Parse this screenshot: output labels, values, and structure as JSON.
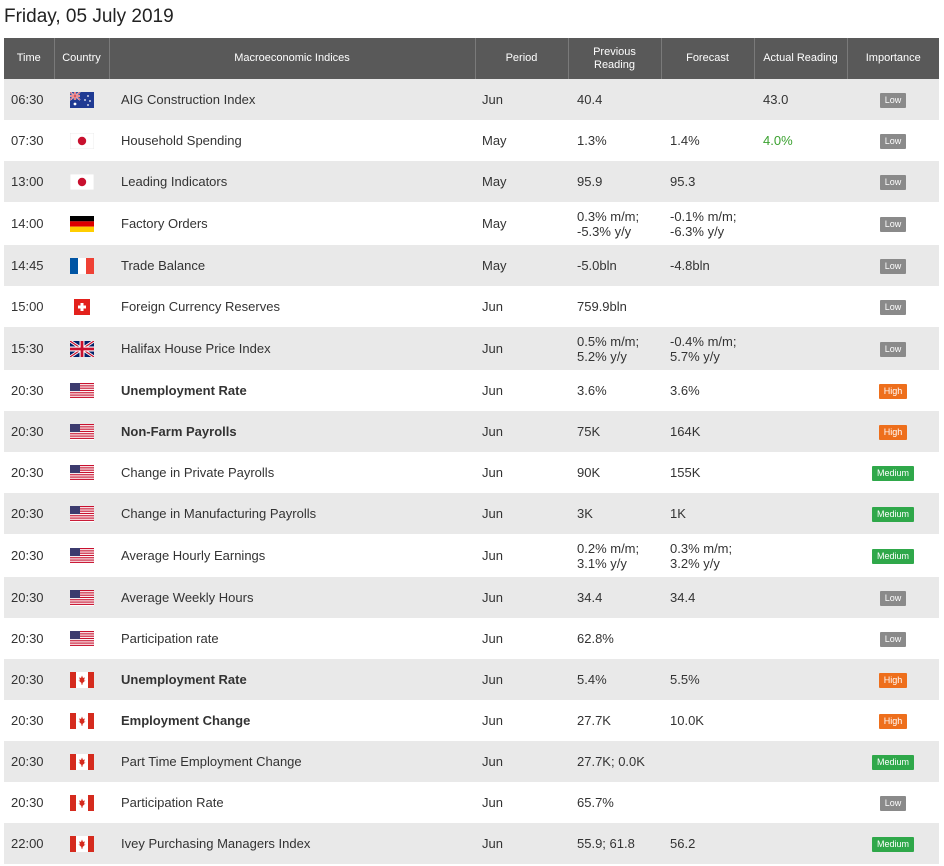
{
  "page": {
    "title": "Friday, 05 July 2019"
  },
  "table": {
    "headers": {
      "time": "Time",
      "country": "Country",
      "indices": "Macroeconomic Indices",
      "period": "Period",
      "previous": "Previous Reading",
      "forecast": "Forecast",
      "actual": "Actual Reading",
      "importance": "Importance"
    },
    "rows": [
      {
        "time": "06:30",
        "country": "au",
        "name": "AIG Construction Index",
        "bold": false,
        "period": "Jun",
        "prev": "40.4",
        "forecast": "",
        "actual": "43.0",
        "actual_green": false,
        "importance": "Low",
        "imp_level": "low"
      },
      {
        "time": "07:30",
        "country": "jp",
        "name": "Household Spending",
        "bold": false,
        "period": "May",
        "prev": "1.3%",
        "forecast": "1.4%",
        "actual": "4.0%",
        "actual_green": true,
        "importance": "Low",
        "imp_level": "low"
      },
      {
        "time": "13:00",
        "country": "jp",
        "name": "Leading Indicators",
        "bold": false,
        "period": "May",
        "prev": "95.9",
        "forecast": "95.3",
        "actual": "",
        "actual_green": false,
        "importance": "Low",
        "imp_level": "low"
      },
      {
        "time": "14:00",
        "country": "de",
        "name": "Factory Orders",
        "bold": false,
        "period": "May",
        "prev": "0.3% m/m;\n-5.3% y/y",
        "forecast": "-0.1% m/m;\n-6.3% y/y",
        "actual": "",
        "actual_green": false,
        "importance": "Low",
        "imp_level": "low"
      },
      {
        "time": "14:45",
        "country": "fr",
        "name": "Trade Balance",
        "bold": false,
        "period": "May",
        "prev": "-5.0bln",
        "forecast": "-4.8bln",
        "actual": "",
        "actual_green": false,
        "importance": "Low",
        "imp_level": "low"
      },
      {
        "time": "15:00",
        "country": "ch",
        "name": "Foreign Currency Reserves",
        "bold": false,
        "period": "Jun",
        "prev": "759.9bln",
        "forecast": "",
        "actual": "",
        "actual_green": false,
        "importance": "Low",
        "imp_level": "low"
      },
      {
        "time": "15:30",
        "country": "gb",
        "name": "Halifax House Price Index",
        "bold": false,
        "period": "Jun",
        "prev": "0.5% m/m;\n5.2% y/y",
        "forecast": "-0.4% m/m;\n5.7% y/y",
        "actual": "",
        "actual_green": false,
        "importance": "Low",
        "imp_level": "low"
      },
      {
        "time": "20:30",
        "country": "us",
        "name": "Unemployment Rate",
        "bold": true,
        "period": "Jun",
        "prev": "3.6%",
        "forecast": "3.6%",
        "actual": "",
        "actual_green": false,
        "importance": "High",
        "imp_level": "high"
      },
      {
        "time": "20:30",
        "country": "us",
        "name": "Non-Farm Payrolls",
        "bold": true,
        "period": "Jun",
        "prev": "75K",
        "forecast": "164K",
        "actual": "",
        "actual_green": false,
        "importance": "High",
        "imp_level": "high"
      },
      {
        "time": "20:30",
        "country": "us",
        "name": "Change in Private Payrolls",
        "bold": false,
        "period": "Jun",
        "prev": "90K",
        "forecast": "155K",
        "actual": "",
        "actual_green": false,
        "importance": "Medium",
        "imp_level": "medium"
      },
      {
        "time": "20:30",
        "country": "us",
        "name": "Change in Manufacturing Payrolls",
        "bold": false,
        "period": "Jun",
        "prev": "3K",
        "forecast": "1K",
        "actual": "",
        "actual_green": false,
        "importance": "Medium",
        "imp_level": "medium"
      },
      {
        "time": "20:30",
        "country": "us",
        "name": "Average Hourly Earnings",
        "bold": false,
        "period": "Jun",
        "prev": "0.2% m/m;\n3.1% y/y",
        "forecast": "0.3% m/m;\n3.2% y/y",
        "actual": "",
        "actual_green": false,
        "importance": "Medium",
        "imp_level": "medium"
      },
      {
        "time": "20:30",
        "country": "us",
        "name": "Average Weekly Hours",
        "bold": false,
        "period": "Jun",
        "prev": "34.4",
        "forecast": "34.4",
        "actual": "",
        "actual_green": false,
        "importance": "Low",
        "imp_level": "low"
      },
      {
        "time": "20:30",
        "country": "us",
        "name": "Participation rate",
        "bold": false,
        "period": "Jun",
        "prev": "62.8%",
        "forecast": "",
        "actual": "",
        "actual_green": false,
        "importance": "Low",
        "imp_level": "low"
      },
      {
        "time": "20:30",
        "country": "ca",
        "name": "Unemployment Rate",
        "bold": true,
        "period": "Jun",
        "prev": "5.4%",
        "forecast": "5.5%",
        "actual": "",
        "actual_green": false,
        "importance": "High",
        "imp_level": "high"
      },
      {
        "time": "20:30",
        "country": "ca",
        "name": "Employment Change",
        "bold": true,
        "period": "Jun",
        "prev": "27.7K",
        "forecast": "10.0K",
        "actual": "",
        "actual_green": false,
        "importance": "High",
        "imp_level": "high"
      },
      {
        "time": "20:30",
        "country": "ca",
        "name": "Part Time Employment Change",
        "bold": false,
        "period": "Jun",
        "prev": "27.7K; 0.0K",
        "forecast": "",
        "actual": "",
        "actual_green": false,
        "importance": "Medium",
        "imp_level": "medium"
      },
      {
        "time": "20:30",
        "country": "ca",
        "name": "Participation Rate",
        "bold": false,
        "period": "Jun",
        "prev": "65.7%",
        "forecast": "",
        "actual": "",
        "actual_green": false,
        "importance": "Low",
        "imp_level": "low"
      },
      {
        "time": "22:00",
        "country": "ca",
        "name": "Ivey Purchasing Managers Index",
        "bold": false,
        "period": "Jun",
        "prev": "55.9; 61.8",
        "forecast": "56.2",
        "actual": "",
        "actual_green": false,
        "importance": "Medium",
        "imp_level": "medium"
      }
    ]
  },
  "colors": {
    "header_bg": "#595959",
    "row_alt": "#e9e9e9",
    "low": "#8a8a8a",
    "high": "#ee6f1c",
    "medium": "#2fa84a",
    "actual_up": "#3aa12f"
  }
}
